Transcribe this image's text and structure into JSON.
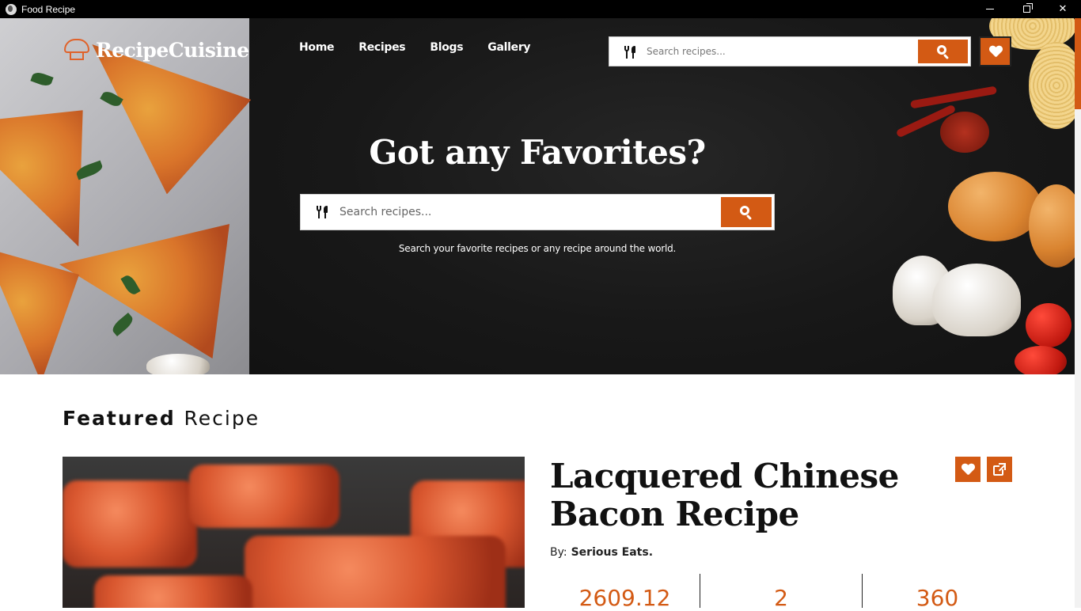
{
  "window": {
    "title": "Food Recipe",
    "controls": [
      "minimize",
      "restore",
      "close"
    ]
  },
  "brand": {
    "logo_text": "RecipeCuisine",
    "logo_icon": "chef-hat-icon"
  },
  "nav": {
    "items": [
      "Home",
      "Recipes",
      "Blogs",
      "Gallery"
    ]
  },
  "top_search": {
    "placeholder": "Search recipes..."
  },
  "hero": {
    "title": "Got any Favorites?",
    "search_placeholder": "Search recipes...",
    "subtitle": "Search your favorite recipes or any recipe around the world."
  },
  "featured": {
    "heading_bold": "Featured",
    "heading_light": "Recipe",
    "recipe_title": "Lacquered Chinese Bacon Recipe",
    "by_label": "By:",
    "author": "Serious Eats.",
    "stats": [
      "2609.12",
      "2",
      "360"
    ]
  },
  "colors": {
    "accent": "#d35a14",
    "hero_bg": "#151515",
    "text": "#111111"
  }
}
